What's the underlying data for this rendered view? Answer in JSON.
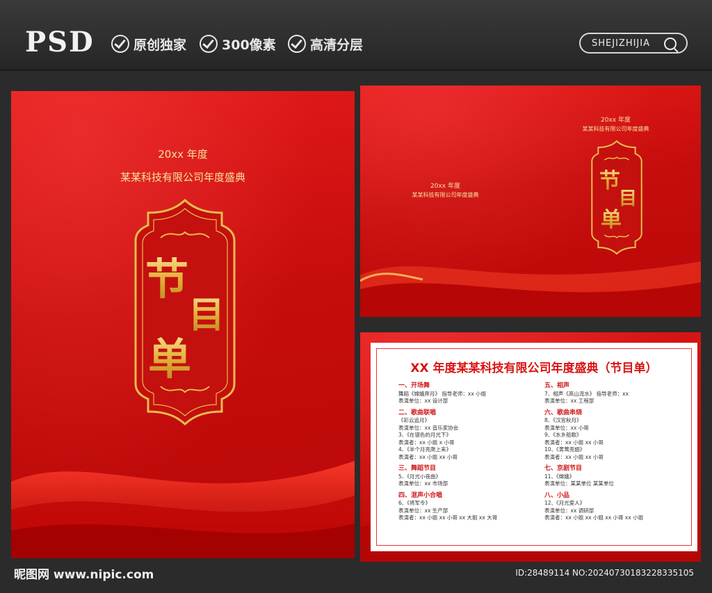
{
  "header": {
    "badge": "PSD",
    "features": [
      "原创独家",
      "300像素",
      "高清分层"
    ],
    "search_label": "SHEJIZHIJIA",
    "search_icon": "magnifier-icon"
  },
  "cover": {
    "year": "20xx 年度",
    "event": "某某科技有限公司年度盛典",
    "title_chars": [
      "节",
      "目",
      "单"
    ]
  },
  "spread": {
    "left_year": "20xx 年度",
    "left_event": "某某科技有限公司年度盛典",
    "right_year": "20xx 年度",
    "right_event": "某某科技有限公司年度盛典",
    "title_chars": [
      "节",
      "目",
      "单"
    ]
  },
  "program": {
    "title": "XX 年度某某科技有限公司年度盛典（节目单）",
    "left_column": [
      {
        "heading": "一、开场舞",
        "lines": [
          "舞蹈《嫦娥奔月》 指导老师：xx 小姐",
          "表演单位：xx 设计部"
        ]
      },
      {
        "heading": "二、歌曲联唱",
        "lines": [
          "《彩云追月》",
          "表演单位：xx 音乐家协会",
          "3、《在银色的月光下》",
          "表演者：xx 小姐  x 小哥",
          "4、《半个月亮爬上来》",
          "表演者：xx 小姐  xx 小哥"
        ]
      },
      {
        "heading": "三、舞蹈节目",
        "lines": [
          "5、《月光小夜曲》",
          "表演单位：xx 市场部"
        ]
      },
      {
        "heading": "四、混声小合唱",
        "lines": [
          "6、《将军令》",
          "表演单位：xx 生产部",
          "表演者：xx 小姐  xx 小哥  xx 大姐  xx 大哥"
        ]
      }
    ],
    "right_column": [
      {
        "heading": "五、相声",
        "lines": [
          "7、相声《高山流水》 指导老师：xx",
          "表演单位：xx 工程部"
        ]
      },
      {
        "heading": "六、歌曲串烧",
        "lines": [
          "8、《汉宫秋月》",
          "表演单位：xx 小哥",
          "9、《水乡船歌》",
          "表演者：xx 小姐  xx 小哥",
          "10、《黄莺亮翅》",
          "表演者：xx 小姐  xx 小哥"
        ]
      },
      {
        "heading": "七、京剧节目",
        "lines": [
          "11、《嫦娥》",
          "表演单位：某某单位 某某单位"
        ]
      },
      {
        "heading": "八、小品",
        "lines": [
          "12、《月光爱人》",
          "表演单位：xx 调研部",
          "表演者：xx 小姐  xx 小姐 xx 小哥  xx 小姐"
        ]
      }
    ]
  },
  "footer": {
    "site": "昵图网 www.nipic.com",
    "id_text": "ID:28489114 NO:20240730183228335105"
  }
}
